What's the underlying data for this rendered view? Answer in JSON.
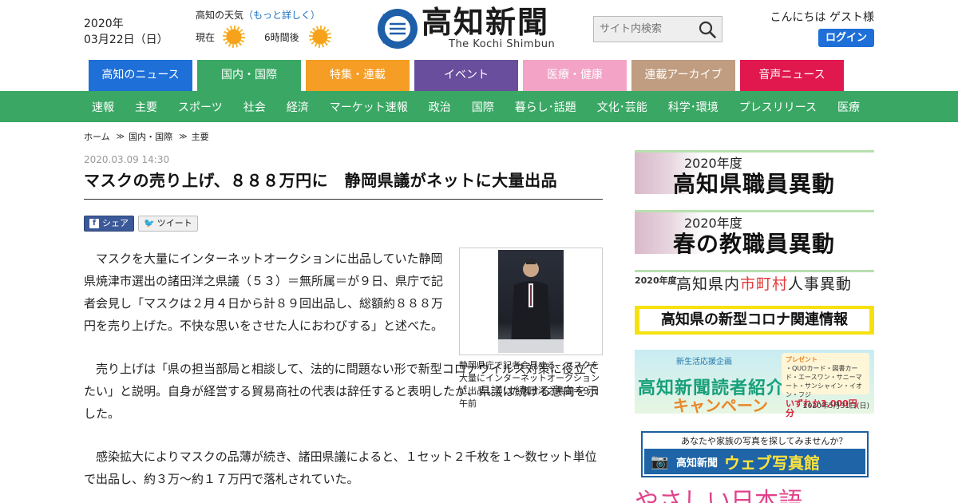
{
  "header": {
    "date_year": "2020年",
    "date_day": "03月22日（日）",
    "weather": {
      "title": "高知の天気",
      "more_link": "（もっと詳しく）",
      "now_label": "現在",
      "later_label": "6時間後",
      "icon": "sun-icon"
    },
    "logo": {
      "title": "高知新聞",
      "subtitle": "The Kochi Shimbun"
    },
    "search": {
      "placeholder": "サイト内検索"
    },
    "greeting": "こんにちは ゲスト様",
    "login_label": "ログイン"
  },
  "categories": [
    {
      "label": "高知のニュース",
      "color": "#1e6fd8"
    },
    {
      "label": "国内・国際",
      "color": "#3aa864"
    },
    {
      "label": "特集・連載",
      "color": "#f59d25"
    },
    {
      "label": "イベント",
      "color": "#6a4e9e"
    },
    {
      "label": "医療・健康",
      "color": "#f2a3c6"
    },
    {
      "label": "連載アーカイブ",
      "color": "#c09d80"
    },
    {
      "label": "音声ニュース",
      "color": "#e0184e"
    }
  ],
  "subnav": [
    "速報",
    "主要",
    "スポーツ",
    "社会",
    "経済",
    "マーケット速報",
    "政治",
    "国際",
    "暮らし･話題",
    "文化･芸能",
    "科学･環境",
    "プレスリリース",
    "医療"
  ],
  "breadcrumb": [
    "ホーム",
    "国内・国際",
    "主要"
  ],
  "article": {
    "timestamp": "2020.03.09 14:30",
    "headline": "マスクの売り上げ、８８８万円に　静岡県議がネットに大量出品",
    "share_label": "シェア",
    "tweet_label": "ツイート",
    "paragraphs": [
      "マスクを大量にインターネットオークションに出品していた静岡県焼津市選出の諸田洋之県議（５３）＝無所属＝が９日、県庁で記者会見し「マスクは２月４日から計８９回出品し、総額約８８８万円を売り上げた。不快な思いをさせた人におわびする」と述べた。",
      "売り上げは「県の担当部局と相談して、法的に問題ない形で新型コロナウイルス対策に役立てたい」と説明。自身が経営する貿易商社の代表は辞任すると表明したが、県議は続ける意向を示した。",
      "感染拡大によりマスクの品薄が続き、諸田県議によると、１セット２千枚を１～数セット単位で出品し、約３万～約１７万円で落札されていた。"
    ],
    "photo_caption": "静岡県庁で記者会見する、マスクを大量にインターネットオークションに出品していた諸田洋之県議＝９日午前"
  },
  "sidebar": {
    "banner1": {
      "year": "2020年度",
      "title": "高知県職員異動"
    },
    "banner2": {
      "year": "2020年度",
      "title": "春の教職員異動"
    },
    "banner3": {
      "year": "2020年度",
      "title_a": "高知県内",
      "title_b": "市町村",
      "title_c": "人事異動"
    },
    "banner4": {
      "title": "高知県の新型コロナ関連情報"
    },
    "banner5": {
      "small": "新生活応援企画",
      "title1": "高知新聞読者紹介",
      "title2": "キャンペーン",
      "prize_head": "プレゼント",
      "prize_items": "・QUOカード・図書カード・エースワン・サニーマート・サンシャイン・イオン・フジ",
      "prize_amount": "いずれか3,000円分",
      "deadline": "2020年5月31日(日)"
    },
    "banner6": {
      "top": "あなたや家族の写真を探してみませんか？",
      "name": "高知新聞",
      "title": "ウェブ写真館"
    },
    "banner7": {
      "title": "やさしい日本語"
    }
  }
}
